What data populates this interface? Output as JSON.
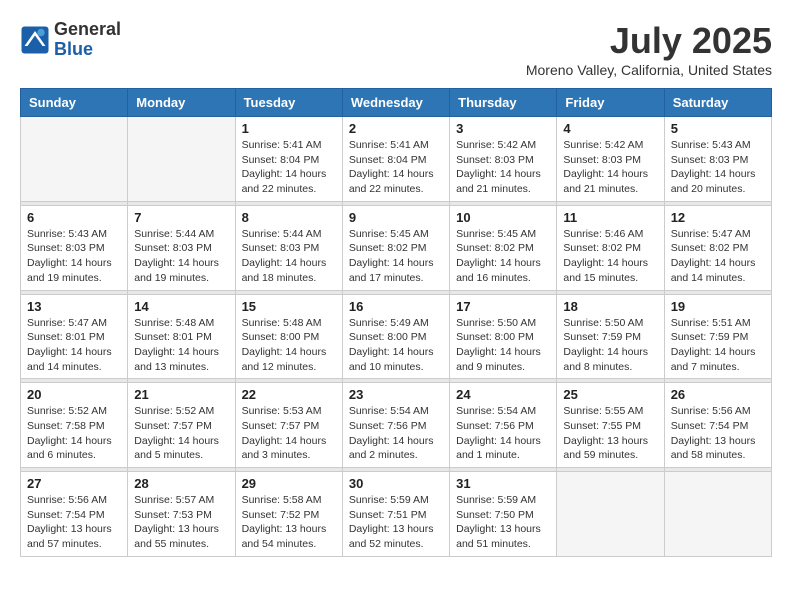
{
  "header": {
    "logo": {
      "line1": "General",
      "line2": "Blue"
    },
    "title": "July 2025",
    "location": "Moreno Valley, California, United States"
  },
  "days_of_week": [
    "Sunday",
    "Monday",
    "Tuesday",
    "Wednesday",
    "Thursday",
    "Friday",
    "Saturday"
  ],
  "weeks": [
    [
      {
        "day": "",
        "info": ""
      },
      {
        "day": "",
        "info": ""
      },
      {
        "day": "1",
        "info": "Sunrise: 5:41 AM\nSunset: 8:04 PM\nDaylight: 14 hours and 22 minutes."
      },
      {
        "day": "2",
        "info": "Sunrise: 5:41 AM\nSunset: 8:04 PM\nDaylight: 14 hours and 22 minutes."
      },
      {
        "day": "3",
        "info": "Sunrise: 5:42 AM\nSunset: 8:03 PM\nDaylight: 14 hours and 21 minutes."
      },
      {
        "day": "4",
        "info": "Sunrise: 5:42 AM\nSunset: 8:03 PM\nDaylight: 14 hours and 21 minutes."
      },
      {
        "day": "5",
        "info": "Sunrise: 5:43 AM\nSunset: 8:03 PM\nDaylight: 14 hours and 20 minutes."
      }
    ],
    [
      {
        "day": "6",
        "info": "Sunrise: 5:43 AM\nSunset: 8:03 PM\nDaylight: 14 hours and 19 minutes."
      },
      {
        "day": "7",
        "info": "Sunrise: 5:44 AM\nSunset: 8:03 PM\nDaylight: 14 hours and 19 minutes."
      },
      {
        "day": "8",
        "info": "Sunrise: 5:44 AM\nSunset: 8:03 PM\nDaylight: 14 hours and 18 minutes."
      },
      {
        "day": "9",
        "info": "Sunrise: 5:45 AM\nSunset: 8:02 PM\nDaylight: 14 hours and 17 minutes."
      },
      {
        "day": "10",
        "info": "Sunrise: 5:45 AM\nSunset: 8:02 PM\nDaylight: 14 hours and 16 minutes."
      },
      {
        "day": "11",
        "info": "Sunrise: 5:46 AM\nSunset: 8:02 PM\nDaylight: 14 hours and 15 minutes."
      },
      {
        "day": "12",
        "info": "Sunrise: 5:47 AM\nSunset: 8:02 PM\nDaylight: 14 hours and 14 minutes."
      }
    ],
    [
      {
        "day": "13",
        "info": "Sunrise: 5:47 AM\nSunset: 8:01 PM\nDaylight: 14 hours and 14 minutes."
      },
      {
        "day": "14",
        "info": "Sunrise: 5:48 AM\nSunset: 8:01 PM\nDaylight: 14 hours and 13 minutes."
      },
      {
        "day": "15",
        "info": "Sunrise: 5:48 AM\nSunset: 8:00 PM\nDaylight: 14 hours and 12 minutes."
      },
      {
        "day": "16",
        "info": "Sunrise: 5:49 AM\nSunset: 8:00 PM\nDaylight: 14 hours and 10 minutes."
      },
      {
        "day": "17",
        "info": "Sunrise: 5:50 AM\nSunset: 8:00 PM\nDaylight: 14 hours and 9 minutes."
      },
      {
        "day": "18",
        "info": "Sunrise: 5:50 AM\nSunset: 7:59 PM\nDaylight: 14 hours and 8 minutes."
      },
      {
        "day": "19",
        "info": "Sunrise: 5:51 AM\nSunset: 7:59 PM\nDaylight: 14 hours and 7 minutes."
      }
    ],
    [
      {
        "day": "20",
        "info": "Sunrise: 5:52 AM\nSunset: 7:58 PM\nDaylight: 14 hours and 6 minutes."
      },
      {
        "day": "21",
        "info": "Sunrise: 5:52 AM\nSunset: 7:57 PM\nDaylight: 14 hours and 5 minutes."
      },
      {
        "day": "22",
        "info": "Sunrise: 5:53 AM\nSunset: 7:57 PM\nDaylight: 14 hours and 3 minutes."
      },
      {
        "day": "23",
        "info": "Sunrise: 5:54 AM\nSunset: 7:56 PM\nDaylight: 14 hours and 2 minutes."
      },
      {
        "day": "24",
        "info": "Sunrise: 5:54 AM\nSunset: 7:56 PM\nDaylight: 14 hours and 1 minute."
      },
      {
        "day": "25",
        "info": "Sunrise: 5:55 AM\nSunset: 7:55 PM\nDaylight: 13 hours and 59 minutes."
      },
      {
        "day": "26",
        "info": "Sunrise: 5:56 AM\nSunset: 7:54 PM\nDaylight: 13 hours and 58 minutes."
      }
    ],
    [
      {
        "day": "27",
        "info": "Sunrise: 5:56 AM\nSunset: 7:54 PM\nDaylight: 13 hours and 57 minutes."
      },
      {
        "day": "28",
        "info": "Sunrise: 5:57 AM\nSunset: 7:53 PM\nDaylight: 13 hours and 55 minutes."
      },
      {
        "day": "29",
        "info": "Sunrise: 5:58 AM\nSunset: 7:52 PM\nDaylight: 13 hours and 54 minutes."
      },
      {
        "day": "30",
        "info": "Sunrise: 5:59 AM\nSunset: 7:51 PM\nDaylight: 13 hours and 52 minutes."
      },
      {
        "day": "31",
        "info": "Sunrise: 5:59 AM\nSunset: 7:50 PM\nDaylight: 13 hours and 51 minutes."
      },
      {
        "day": "",
        "info": ""
      },
      {
        "day": "",
        "info": ""
      }
    ]
  ]
}
